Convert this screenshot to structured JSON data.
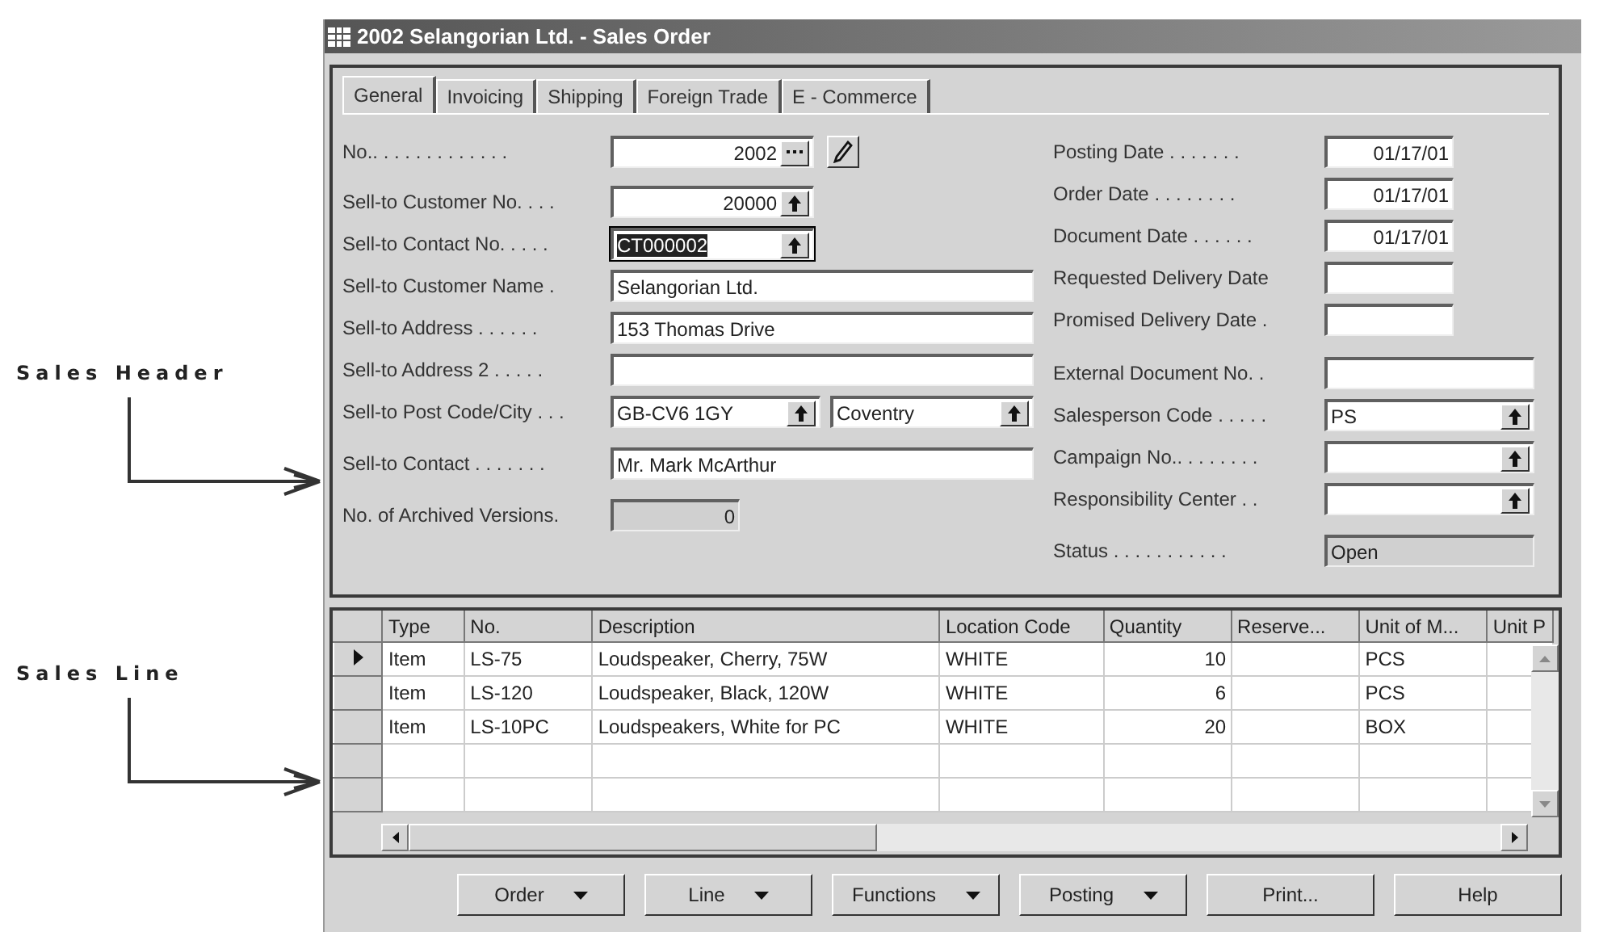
{
  "annotations": [
    {
      "label": "Sales Header"
    },
    {
      "label": "Sales Line"
    }
  ],
  "window": {
    "title": "2002 Selangorian Ltd. - Sales Order"
  },
  "tabs": [
    {
      "label": "General",
      "selected": true
    },
    {
      "label": "Invoicing",
      "selected": false
    },
    {
      "label": "Shipping",
      "selected": false
    },
    {
      "label": "Foreign Trade",
      "selected": false
    },
    {
      "label": "E - Commerce",
      "selected": false
    }
  ],
  "left_fields": [
    {
      "label": "No.. . . . . . . . . . . . .",
      "kind": "assist",
      "value": "2002",
      "focused": false
    },
    {
      "label": "Sell-to Customer No. . . .",
      "kind": "number_lookup",
      "value": "20000",
      "focused": false
    },
    {
      "label": "Sell-to Contact No. . . . .",
      "kind": "code_lookup",
      "value": "CT000002",
      "focused": true
    },
    {
      "label": "Sell-to Customer Name  .",
      "kind": "text",
      "value": "Selangorian Ltd.",
      "focused": false
    },
    {
      "label": "Sell-to Address . . . . . .",
      "kind": "text",
      "value": "153 Thomas Drive",
      "focused": false
    },
    {
      "label": "Sell-to Address 2 . . . . .",
      "kind": "text",
      "focused": false
    },
    {
      "label": "Sell-to Post Code/City . . .",
      "kind": "pair",
      "value": "GB-CV6 1GY",
      "value_2": "Coventry",
      "focused": false
    },
    {
      "label": "Sell-to Contact . . . . . . .",
      "kind": "text",
      "value": "Mr. Mark McArthur",
      "focused": false
    },
    {
      "label": "No. of Archived Versions.",
      "kind": "readonly",
      "value": "0",
      "focused": false
    }
  ],
  "right_fields": [
    {
      "label": "Posting Date . . . . . . .",
      "kind": "date",
      "value": "01/17/01"
    },
    {
      "label": "Order Date . . . . . . . .",
      "kind": "date",
      "value": "01/17/01"
    },
    {
      "label": "Document Date . . . . . .",
      "kind": "date",
      "value": "01/17/01"
    },
    {
      "label": "Requested Delivery Date",
      "kind": "date"
    },
    {
      "label": "Promised Delivery Date  .",
      "kind": "date"
    },
    {
      "label": "External Document No.  .",
      "kind": "text"
    },
    {
      "label": "Salesperson Code . . . . .",
      "kind": "lookup",
      "value": "PS"
    },
    {
      "label": "Campaign No.. . . . . . . .",
      "kind": "lookup"
    },
    {
      "label": "Responsibility Center  . .",
      "kind": "lookup"
    },
    {
      "label": "Status . . . . . . . . . . .",
      "kind": "readonly",
      "value": "Open"
    }
  ],
  "lines": {
    "columns": [
      {
        "label": "Type",
        "kind": "text"
      },
      {
        "label": "No.",
        "kind": "text"
      },
      {
        "label": "Description",
        "kind": "text"
      },
      {
        "label": "Location Code",
        "kind": "text"
      },
      {
        "label": "Quantity",
        "kind": "number"
      },
      {
        "label": "Reserve..."
      },
      {
        "label": "Unit of M...",
        "kind": "text"
      },
      {
        "label": "Unit P"
      }
    ],
    "rows": [
      {
        "current": true,
        "cells": [
          "Item",
          "LS-75",
          "Loudspeaker, Cherry, 75W",
          "WHITE",
          "10",
          "",
          "PCS"
        ]
      },
      {
        "current": false,
        "cells": [
          "Item",
          "LS-120",
          "Loudspeaker, Black, 120W",
          "WHITE",
          "6",
          "",
          "PCS"
        ]
      },
      {
        "current": false,
        "cells": [
          "Item",
          "LS-10PC",
          "Loudspeakers, White for PC",
          "WHITE",
          "20",
          "",
          "BOX"
        ]
      }
    ]
  },
  "buttons": [
    {
      "label": "Order",
      "kind": "menu"
    },
    {
      "label": "Line",
      "kind": "menu"
    },
    {
      "label": "Functions",
      "kind": "menu"
    },
    {
      "label": "Posting",
      "kind": "menu"
    },
    {
      "label": "Print...",
      "kind": "plain"
    },
    {
      "label": "Help",
      "kind": "plain"
    }
  ]
}
